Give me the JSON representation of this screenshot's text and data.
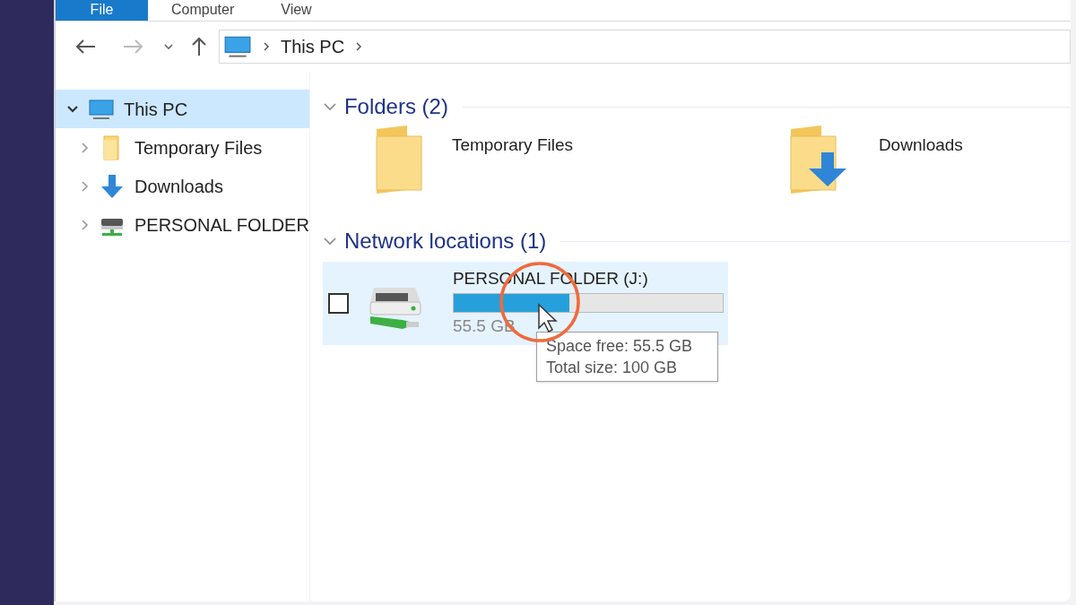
{
  "ribbon_tabs": [
    {
      "label": "File",
      "selected": true
    },
    {
      "label": "Computer",
      "selected": false
    },
    {
      "label": "View",
      "selected": false
    }
  ],
  "address_bar": {
    "path": [
      "This PC"
    ]
  },
  "navigation": [
    {
      "label": "This PC",
      "kind": "pc",
      "expanded": true,
      "selected": true
    },
    {
      "label": "Temporary Files",
      "kind": "folder",
      "expanded": false,
      "selected": false
    },
    {
      "label": "Downloads",
      "kind": "downloads",
      "expanded": false,
      "selected": false
    },
    {
      "label": "PERSONAL FOLDER",
      "kind": "network",
      "expanded": false,
      "selected": false
    }
  ],
  "groups": [
    {
      "title": "Folders (2)",
      "expanded": true,
      "items": [
        {
          "name": "Temporary Files",
          "kind": "folder"
        },
        {
          "name": "Downloads",
          "kind": "downloads"
        }
      ]
    },
    {
      "title": "Network locations (1)",
      "expanded": true,
      "items": [
        {
          "name": "PERSONAL FOLDER (J:)",
          "kind": "drive",
          "level": 0.43,
          "free_text": "55.5 GB",
          "selected": true,
          "checked": false
        }
      ]
    }
  ],
  "tooltip": {
    "lines": [
      "Space free: 55.5 GB",
      "Total size: 100 GB"
    ]
  }
}
